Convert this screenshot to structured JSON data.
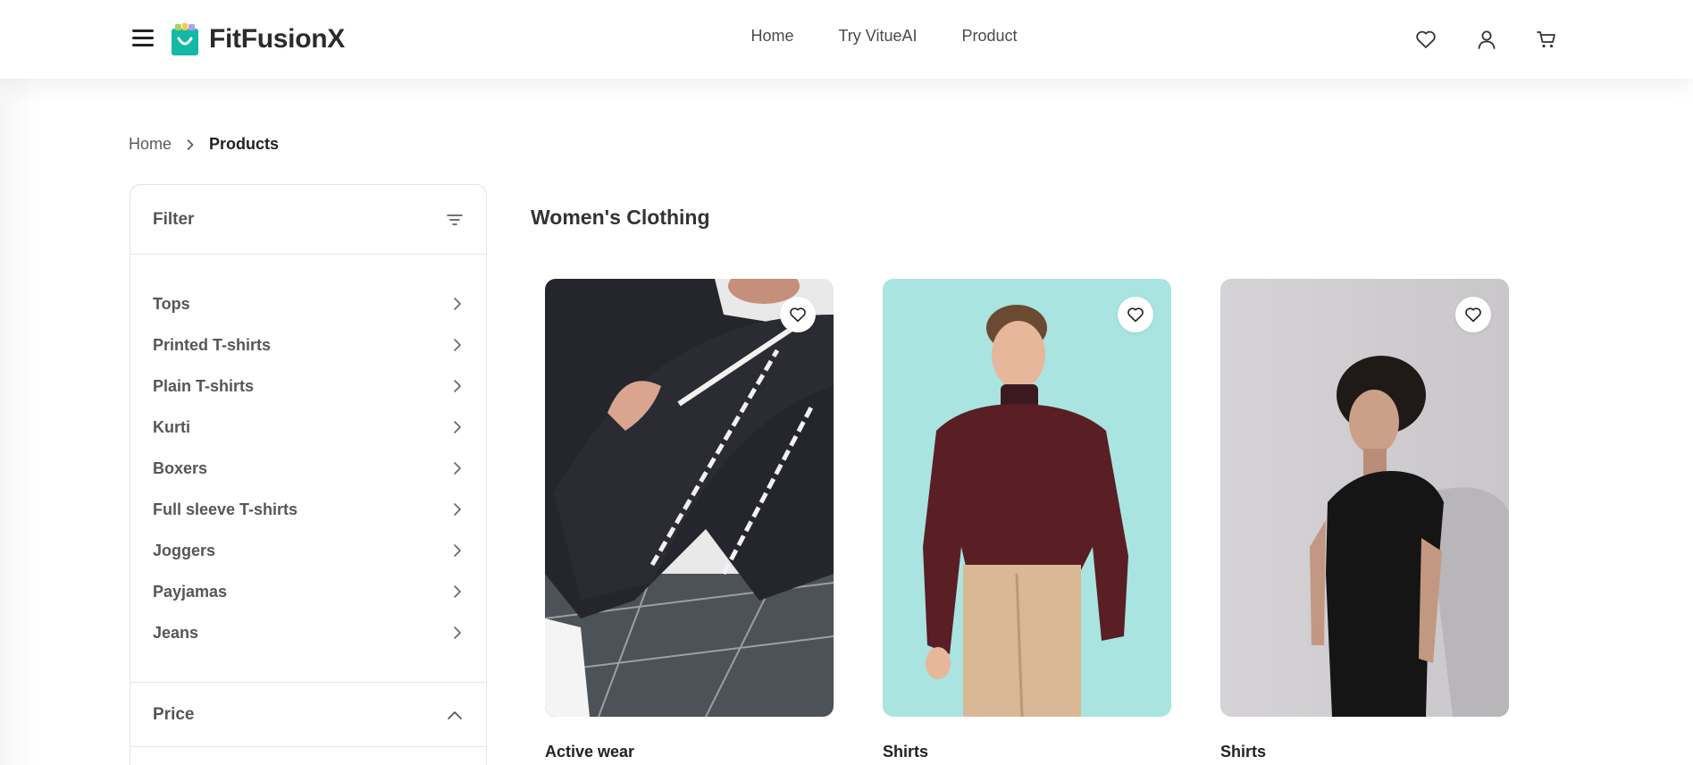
{
  "header": {
    "brand": "FitFusionX",
    "nav": [
      "Home",
      "Try VitueAI",
      "Product"
    ]
  },
  "breadcrumb": {
    "home": "Home",
    "current": "Products"
  },
  "filter": {
    "title": "Filter",
    "categories": [
      "Tops",
      "Printed T-shirts",
      "Plain T-shirts",
      "Kurti",
      "Boxers",
      "Full sleeve T-shirts",
      "Joggers",
      "Payjamas",
      "Jeans"
    ],
    "price_title": "Price"
  },
  "main": {
    "title": "Women's Clothing",
    "products": [
      {
        "name": "Active wear",
        "image": "man-sitting-black-tracksuit",
        "bg": "#4a4a50"
      },
      {
        "name": "Shirts",
        "image": "man-maroon-turtleneck",
        "bg": "#a9e4e1"
      },
      {
        "name": "Shirts",
        "image": "man-black-tshirt",
        "bg": "#d7d6d8"
      }
    ]
  },
  "colors": {
    "logo_bag": "#14b8a6",
    "text": "#222222",
    "border": "#e4e4e4"
  }
}
